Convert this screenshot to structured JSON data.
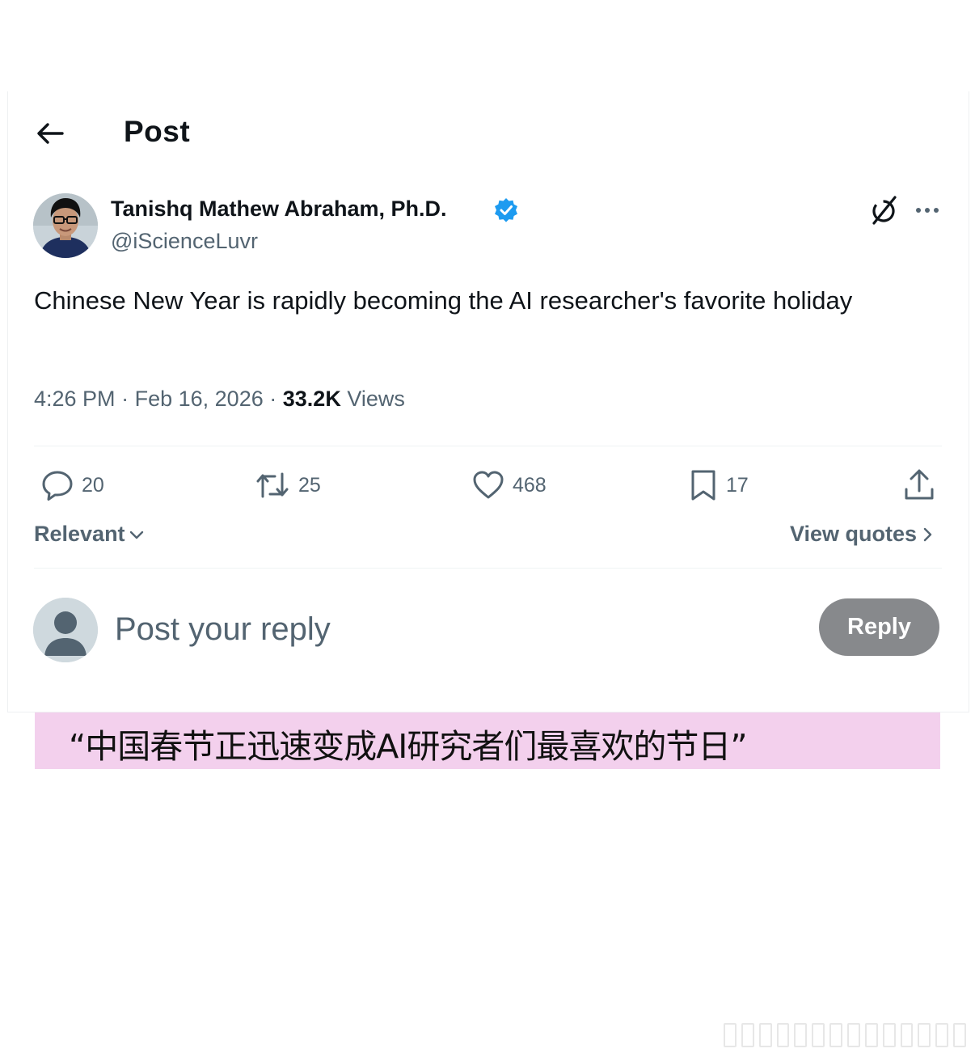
{
  "header": {
    "back_icon": "arrow-left-icon",
    "title": "Post"
  },
  "post": {
    "author_name": "Tanishq Mathew Abraham, Ph.D.",
    "handle": "@iScienceLuvr",
    "verified_color": "#1d9bf0",
    "text": "Chinese New Year is rapidly becoming the AI researcher's favorite holiday",
    "time": "4:26 PM",
    "date": "Feb 16, 2026",
    "separator": "·",
    "views_count": "33.2K",
    "views_label": "Views"
  },
  "actions": {
    "replies": "20",
    "reposts": "25",
    "likes": "468",
    "bookmarks": "17"
  },
  "sort": {
    "relevant_label": "Relevant",
    "view_quotes_label": "View quotes"
  },
  "reply_box": {
    "placeholder": "Post your reply",
    "button_label": "Reply"
  },
  "caption": {
    "text": "“中国春节正迅速变成AI研究者们最喜欢的节日”",
    "background": "#f3d0ed"
  }
}
